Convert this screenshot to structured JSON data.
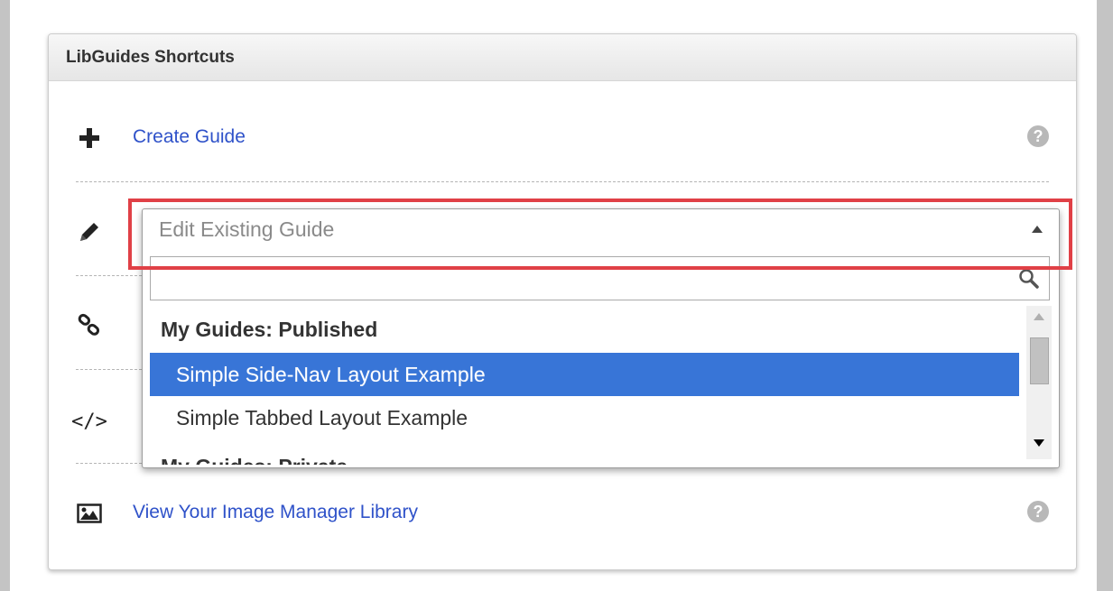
{
  "panel": {
    "title": "LibGuides Shortcuts"
  },
  "shortcuts": [
    {
      "icon": "plus-icon",
      "label": "Create Guide",
      "help": "?"
    },
    {
      "icon": "pencil-icon",
      "label": "Edit Existing Guide"
    },
    {
      "icon": "link-icon",
      "label": ""
    },
    {
      "icon": "code-icon",
      "label": ""
    },
    {
      "icon": "image-icon",
      "label": "View Your Image Manager Library",
      "help": "?"
    }
  ],
  "dropdown": {
    "placeholder": "Edit Existing Guide",
    "search_value": "",
    "groups": [
      {
        "label": "My Guides: Published",
        "options": [
          {
            "label": "Simple Side-Nav Layout Example",
            "selected": true
          },
          {
            "label": "Simple Tabbed Layout Example",
            "selected": false
          }
        ]
      },
      {
        "label": "My Guides: Private",
        "options": []
      }
    ]
  },
  "colors": {
    "link": "#2f52c9",
    "selected_bg": "#3875d7",
    "highlight": "#e04046"
  }
}
